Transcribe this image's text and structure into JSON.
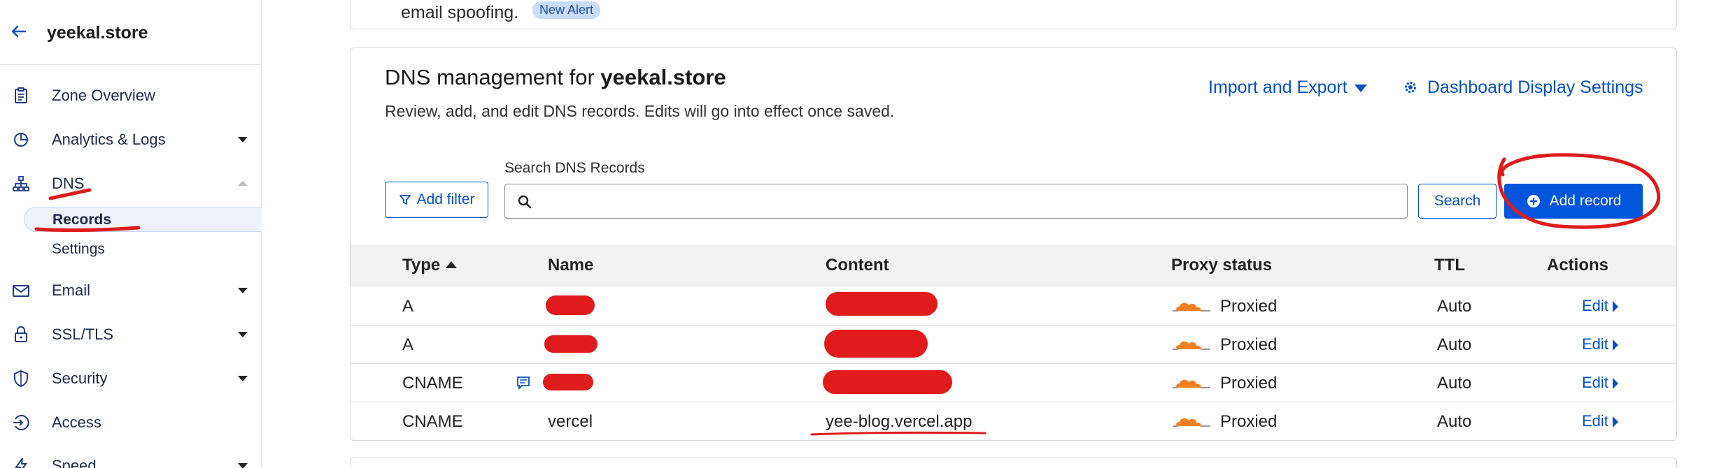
{
  "sidebar": {
    "zone_name": "yeekal.store",
    "items": [
      {
        "label": "Zone Overview",
        "icon": "clipboard-icon",
        "expandable": false
      },
      {
        "label": "Analytics & Logs",
        "icon": "pie-chart-icon",
        "expandable": true
      },
      {
        "label": "DNS",
        "icon": "network-icon",
        "expandable": true,
        "expanded": true
      },
      {
        "label": "Email",
        "icon": "envelope-icon",
        "expandable": true
      },
      {
        "label": "SSL/TLS",
        "icon": "lock-icon",
        "expandable": true
      },
      {
        "label": "Security",
        "icon": "shield-icon",
        "expandable": true
      },
      {
        "label": "Access",
        "icon": "access-icon",
        "expandable": false
      },
      {
        "label": "Speed",
        "icon": "lightning-icon",
        "expandable": true
      }
    ],
    "dns_sub_items": [
      {
        "label": "Records",
        "active": true
      },
      {
        "label": "Settings",
        "active": false
      }
    ]
  },
  "top_card": {
    "text": "email spoofing.",
    "badge": "New Alert"
  },
  "dns": {
    "title_prefix": "DNS management for ",
    "title_zone": "yeekal.store",
    "subtitle": "Review, add, and edit DNS records. Edits will go into effect once saved.",
    "import_export_label": "Import and Export",
    "display_settings_label": "Dashboard Display Settings",
    "add_filter_label": "Add filter",
    "search_label": "Search DNS Records",
    "search_value": "",
    "search_button_label": "Search",
    "add_record_label": "Add record"
  },
  "table": {
    "headers": {
      "type": "Type",
      "name": "Name",
      "content": "Content",
      "proxy": "Proxy status",
      "ttl": "TTL",
      "actions": "Actions"
    },
    "rows": [
      {
        "type": "A",
        "name": "",
        "content": "",
        "proxy": "Proxied",
        "ttl": "Auto",
        "action": "Edit",
        "has_comment": false
      },
      {
        "type": "A",
        "name": "",
        "content": "",
        "proxy": "Proxied",
        "ttl": "Auto",
        "action": "Edit",
        "has_comment": false
      },
      {
        "type": "CNAME",
        "name": "",
        "content": "",
        "proxy": "Proxied",
        "ttl": "Auto",
        "action": "Edit",
        "has_comment": true
      },
      {
        "type": "CNAME",
        "name": "vercel",
        "content": "yee-blog.vercel.app",
        "proxy": "Proxied",
        "ttl": "Auto",
        "action": "Edit",
        "has_comment": false
      }
    ]
  },
  "colors": {
    "link_blue": "#0051c3",
    "primary_button": "#0055dc",
    "cloud_orange": "#f38020",
    "annotation_red": "#e01b1b"
  }
}
